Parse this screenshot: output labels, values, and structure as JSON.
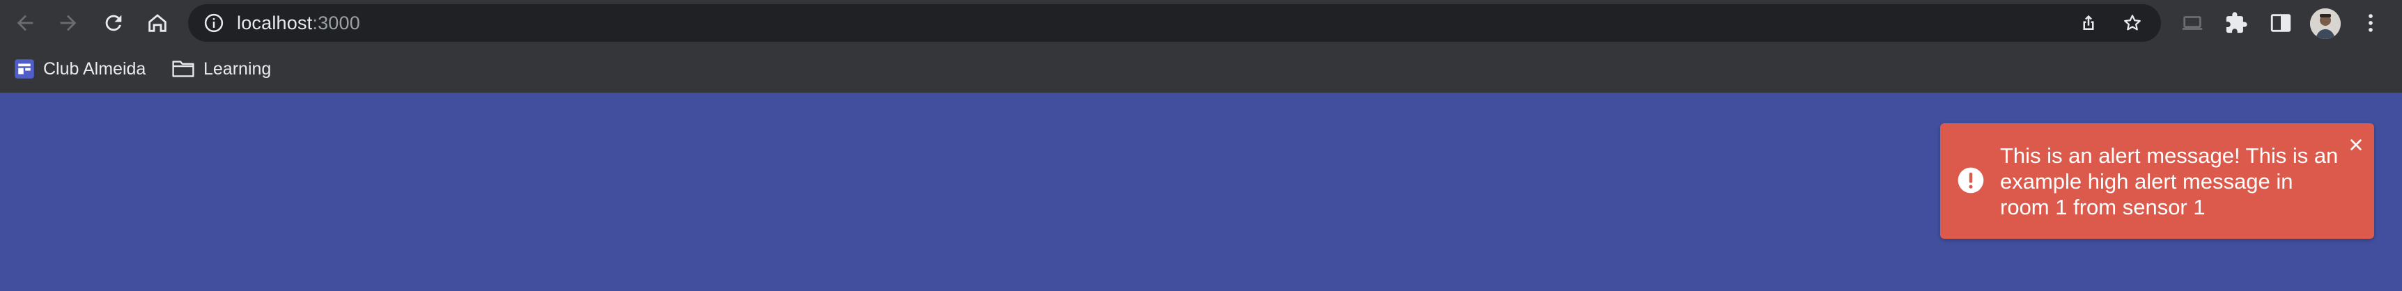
{
  "browser": {
    "address_bar": {
      "host": "localhost",
      "port": ":3000"
    },
    "icons": {
      "back": "arrow-back-icon",
      "forward": "arrow-forward-icon",
      "reload": "reload-icon",
      "home": "home-icon",
      "info": "info-icon",
      "share": "share-icon",
      "bookmark": "star-icon",
      "cast": "cast-icon",
      "extensions": "puzzle-icon",
      "side_panel": "side-panel-icon",
      "menu": "kebab-menu-icon"
    },
    "bookmarks": [
      {
        "label": "Club Almeida",
        "icon": "site-icon"
      },
      {
        "label": "Learning",
        "icon": "folder-icon"
      }
    ]
  },
  "page": {
    "background": "#424f9e",
    "alert": {
      "message": "This is an alert message! This is an example high alert message in room 1 from sensor 1",
      "color": "#dc5a4b",
      "icon": "exclamation-circle-icon",
      "close_icon": "close-icon"
    }
  }
}
